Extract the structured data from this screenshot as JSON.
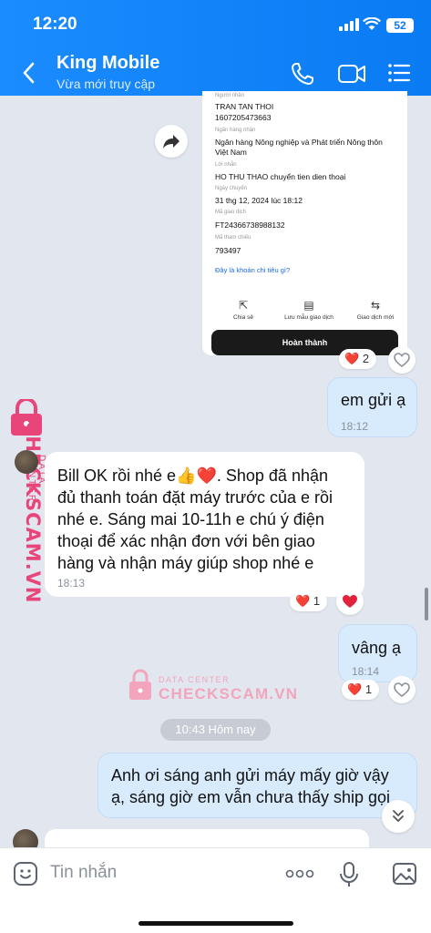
{
  "status": {
    "time": "12:20",
    "battery": "52"
  },
  "header": {
    "title": "King Mobile",
    "subtitle": "Vừa mới truy cập"
  },
  "receipt": {
    "recipient_label": "Người nhận",
    "recipient_name": "TRAN TAN THOI",
    "recipient_account": "1607205473663",
    "bank_label": "Ngân hàng nhận",
    "bank_name_line1": "Ngân hàng Nông nghiệp và Phát triển Nông thôn",
    "bank_name_line2": "Việt Nam",
    "message_label": "Lời nhắn",
    "message": "HO THU THAO chuyển tien dien thoại",
    "date_label": "Ngày chuyển",
    "date": "31 thg 12, 2024 lúc 18:12",
    "txid_label": "Mã giao dịch",
    "txid": "FT24366738988132",
    "ref_label": "Mã tham chiếu",
    "ref": "793497",
    "link": "Đây là khoản chi tiêu gì?",
    "actions": [
      "Chia sẻ",
      "Lưu mẫu giao dịch",
      "Giao dịch mới"
    ],
    "done_button": "Hoàn thành"
  },
  "messages": [
    {
      "side": "me",
      "line1": "em gửi ạ",
      "time": "18:12"
    },
    {
      "side": "them",
      "lines": [
        "Bill OK rồi nhé e👍❤️. Shop đã nhận",
        "đủ thanh toán đặt máy trước của e rồi",
        "nhé e. Sáng mai 10-11h e chú ý điện",
        "thoại để xác nhận đơn với bên giao",
        "hàng và nhận máy giúp shop nhé e"
      ],
      "time": "18:13"
    },
    {
      "side": "me",
      "line1": "vâng ạ",
      "time": "18:14"
    },
    {
      "side": "me",
      "lines": [
        "Anh ơi sáng anh gửi máy mấy giờ vậy",
        "ạ, sáng giờ em vẫn chưa thấy ship gọi"
      ]
    }
  ],
  "reactions": {
    "receipt_count": "2",
    "msg2_count": "1",
    "msg3_count": "1",
    "heart": "❤️"
  },
  "date_separator": "10:43 Hôm nay",
  "watermark": {
    "brand": "CHECKSCAM.VN",
    "sub": "DATA CENTER"
  },
  "composer": {
    "placeholder": "Tin nhắn"
  },
  "colors": {
    "header": "#0a7bf3",
    "my_bubble": "#d8ebfc",
    "background": "#e2e6ee"
  }
}
